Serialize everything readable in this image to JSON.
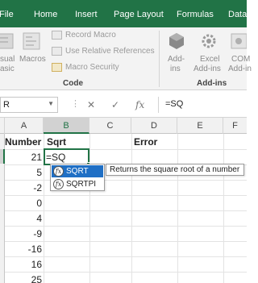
{
  "ribbon_tabs": [
    "File",
    "Home",
    "Insert",
    "Page Layout",
    "Formulas",
    "Data"
  ],
  "ribbon": {
    "code_group": {
      "visual_basic_label_1": "sual",
      "visual_basic_label_2": "asic",
      "macros_label": "Macros",
      "record_macro": "Record Macro",
      "use_relative_references": "Use Relative References",
      "macro_security": "Macro Security",
      "title": "Code"
    },
    "addins_group": {
      "addins_label_1": "Add-",
      "addins_label_2": "ins",
      "excel_addins_label_1": "Excel",
      "excel_addins_label_2": "Add-ins",
      "com_addins_label_1": "COM",
      "com_addins_label_2": "Add-in",
      "title": "Add-ins"
    }
  },
  "formula_bar": {
    "name_box": "R",
    "cancel_glyph": "✕",
    "enter_glyph": "✓",
    "fx_glyph": "fx",
    "formula": "=SQ"
  },
  "columns": [
    "A",
    "B",
    "C",
    "D",
    "E",
    "F"
  ],
  "selected_column": "B",
  "headers": {
    "number": "Number",
    "sqrt": "Sqrt",
    "error": "Error"
  },
  "numbers": [
    "21",
    "5",
    "-2",
    "0",
    "4",
    "-9",
    "-16",
    "16",
    "25"
  ],
  "active_cell_text": "=SQ",
  "autocomplete": {
    "items": [
      "SQRT",
      "SQRTPI"
    ],
    "selected": "SQRT",
    "tooltip": "Returns the square root of a number"
  },
  "colors": {
    "accent": "#217346",
    "selection": "#1f6fc5"
  }
}
